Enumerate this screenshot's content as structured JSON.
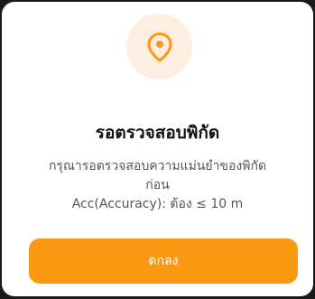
{
  "dialog": {
    "icon": "map-pin-icon",
    "title": "รอตรวจสอบพิกัด",
    "message_line1": "กรุณารอตรวจสอบความแม่นยำของพิกัด",
    "message_line2": "ก่อน",
    "message_line3": "Acc(Accuracy): ต้อง ≤ 10 m",
    "button_label": "ตกลง"
  },
  "colors": {
    "accent": "#fb9a12",
    "icon_bg": "#fdeee0",
    "title": "#111111",
    "message": "#555555"
  }
}
